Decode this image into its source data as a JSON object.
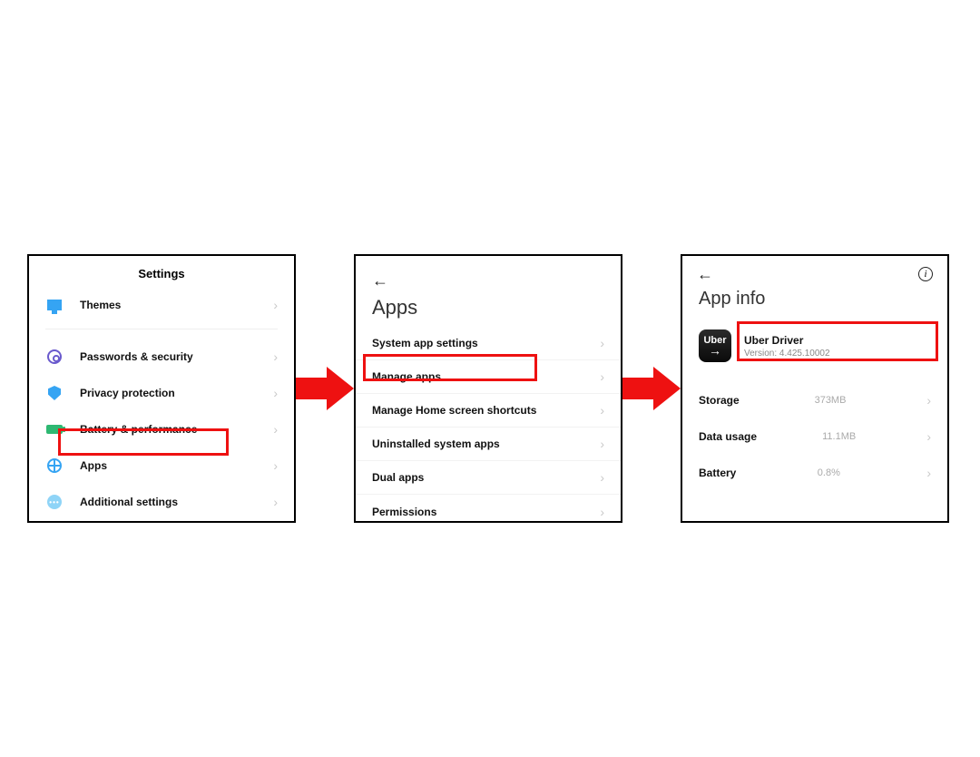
{
  "p1": {
    "title": "Settings",
    "items": [
      {
        "key": "themes",
        "label": "Themes"
      },
      {
        "key": "pwd",
        "label": "Passwords & security"
      },
      {
        "key": "privacy",
        "label": "Privacy protection"
      },
      {
        "key": "battery",
        "label": "Battery & performance"
      },
      {
        "key": "apps",
        "label": "Apps"
      },
      {
        "key": "addl",
        "label": "Additional settings"
      }
    ],
    "highlight_key": "apps"
  },
  "p2": {
    "heading": "Apps",
    "items": [
      {
        "key": "sysapp",
        "label": "System app settings"
      },
      {
        "key": "manage",
        "label": "Manage apps"
      },
      {
        "key": "shortcuts",
        "label": "Manage Home screen shortcuts"
      },
      {
        "key": "uninst",
        "label": "Uninstalled system apps"
      },
      {
        "key": "dual",
        "label": "Dual apps"
      },
      {
        "key": "perm",
        "label": "Permissions"
      }
    ],
    "highlight_key": "manage"
  },
  "p3": {
    "heading": "App info",
    "app": {
      "icon_text": "Uber",
      "name": "Uber Driver",
      "version_label": "Version: 4.425.10002"
    },
    "rows": [
      {
        "key": "storage",
        "label": "Storage",
        "value": "373MB"
      },
      {
        "key": "data",
        "label": "Data usage",
        "value": "11.1MB"
      },
      {
        "key": "battery",
        "label": "Battery",
        "value": "0.8%"
      }
    ]
  },
  "chevron": "›"
}
